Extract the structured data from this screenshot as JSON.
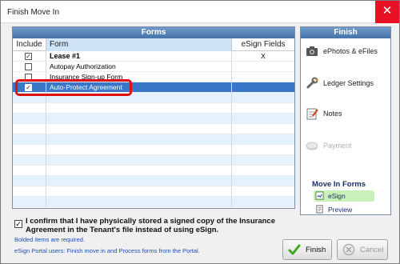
{
  "window": {
    "title": "Finish Move In",
    "close_glyph": "✕"
  },
  "forms_panel": {
    "header": "Forms",
    "columns": {
      "include": "Include",
      "form": "Form",
      "esign": "eSign Fields"
    },
    "rows": [
      {
        "checked": true,
        "check_glyph": "✓",
        "name": "Lease #1",
        "esign": "X",
        "bold": true
      },
      {
        "checked": false,
        "check_glyph": "",
        "name": "Autopay Authorization",
        "esign": ""
      },
      {
        "checked": false,
        "check_glyph": "",
        "name": "Insurance Sign-up Form",
        "esign": ""
      },
      {
        "checked": true,
        "check_glyph": "✓",
        "name": "Auto-Protect Agreement",
        "esign": "",
        "selected": true
      }
    ]
  },
  "finish_panel": {
    "header": "Finish",
    "items": {
      "ephotos": "ePhotos & eFiles",
      "ledger": "Ledger Settings",
      "notes": "Notes",
      "payment": "Payment"
    },
    "move_in_forms": {
      "title": "Move In Forms",
      "esign": "eSign",
      "preview": "Preview"
    }
  },
  "confirm": {
    "checked": true,
    "check_glyph": "✓",
    "text": "I confirm that I have physically stored a signed copy of the Insurance Agreement in the Tenant's file instead of using eSign."
  },
  "notes": {
    "bolded": "Bolded items are required.",
    "portal": "eSign Portal users: Finish move in and Process forms from the Portal."
  },
  "buttons": {
    "finish": "Finish",
    "cancel": "Cancel"
  },
  "colors": {
    "header_blue": "#4673a8",
    "selected_row": "#3a77c8",
    "highlight_red": "#e01010",
    "active_green": "#c8f0b8",
    "close_red": "#e81123"
  }
}
